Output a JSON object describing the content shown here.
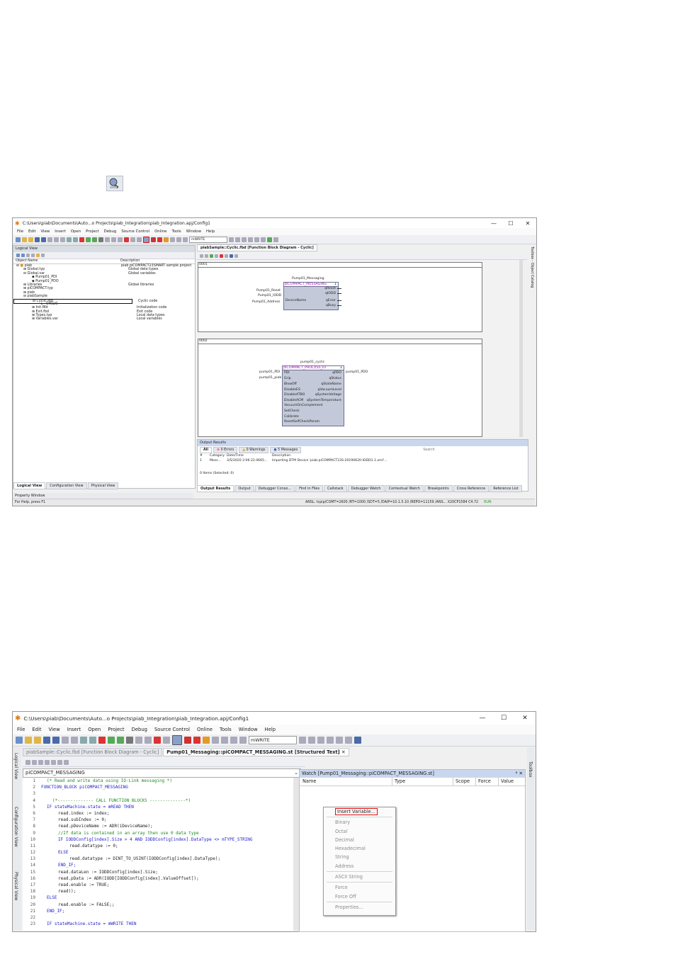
{
  "screen1": {
    "title": "C:\\Users\\piab\\Documents\\Auto...o Projects\\piab_Integration\\piab_Integration.apj/Config1",
    "menu": [
      "File",
      "Edit",
      "View",
      "Insert",
      "Open",
      "Project",
      "Debug",
      "Source Control",
      "Online",
      "Tools",
      "Window",
      "Help"
    ],
    "toolbar_combo": "mWRITE",
    "logical_view": {
      "header": "Logical View",
      "col_object": "Object Name",
      "col_desc": "Description",
      "rows": [
        {
          "name": "piab",
          "desc": "piab piCOMPACT23SMART sample project"
        },
        {
          "name": "Global.typ",
          "desc": "Global data types"
        },
        {
          "name": "Global.var",
          "desc": "Global variables"
        },
        {
          "name": "Pump01_PDI",
          "desc": ""
        },
        {
          "name": "Pump01_PDO",
          "desc": ""
        },
        {
          "name": "Libraries",
          "desc": "Global libraries"
        },
        {
          "name": "piCOMPACT.typ",
          "desc": ""
        },
        {
          "name": "piab",
          "desc": ""
        },
        {
          "name": "piabSample",
          "desc": ""
        },
        {
          "name": "Cyclic.fbd",
          "desc": "Cyclic code"
        },
        {
          "name": "_CYCLIC",
          "desc": ""
        },
        {
          "name": "Init.fbd",
          "desc": "Initialization code"
        },
        {
          "name": "Exit.fbd",
          "desc": "Exit code"
        },
        {
          "name": "Types.typ",
          "desc": "Local data types"
        },
        {
          "name": "Variables.var",
          "desc": "Local variables"
        }
      ],
      "bottom_tabs": [
        "Logical View",
        "Configuration View",
        "Physical View"
      ],
      "property_window": "Property Window"
    },
    "editor_tab": "piabSample::Cyclic.fbd [Function Block Diagram - Cyclic]",
    "network1": {
      "id": "0001",
      "instance": "Pump01_Messaging",
      "fb_type": "piCOMPACT_MESSAGING",
      "fb_index": "1",
      "inputs_external": [
        "Pump01_Reset",
        "Pump01_IODD",
        "Pump01_Address"
      ],
      "inputs": [
        "",
        "",
        "DeviceName"
      ],
      "outputs": [
        "qReset",
        "qIODD",
        "qError",
        "qBusy"
      ]
    },
    "network2": {
      "id": "0002",
      "instance": "pump01_cyclic",
      "fb_type": "piCOMPACT_PROCESS_IO",
      "fb_index": "1",
      "inputs_external": [
        "pump01_PDI",
        "pump01_piab"
      ],
      "inputs": [
        "PDI",
        "Grip",
        "BlowOff",
        "DisableES",
        "DisableATBO",
        "DisableACM",
        "VacuumOnComplement",
        "SetCheck",
        "Calibrate",
        "ResetSelfCheckParam"
      ],
      "outputs": [
        "qPDO",
        "qStatus",
        "qStateName",
        "qVacuumLevel",
        "qSystemVoltage",
        "qSystemTemperature"
      ],
      "output_external": "pump01_PDO"
    },
    "output": {
      "header": "Output Results",
      "filters": [
        "All",
        "0 Errors",
        "0 Warnings",
        "5 Messages"
      ],
      "search": "Search",
      "cols": [
        "#",
        "Category",
        "Date/Time",
        "Description"
      ],
      "row": {
        "num": "1",
        "category": "Mess...",
        "time": "3/5/2020 2:06:22.0665...",
        "desc": "Importing DTM Device 'piab-piCOMPACT23S-20190620-IODD1.1.xml'..."
      },
      "footer": "0 Items (Selected: 0)",
      "tabs": [
        "Output Results",
        "Output",
        "Debugger Conso...",
        "Find in Files",
        "Callstack",
        "Debugger Watch",
        "Contextual Watch",
        "Breakpoints",
        "Cross Reference",
        "Reference List"
      ]
    },
    "status_left": "For Help, press F1",
    "status_right": "ANSL: tcpip/COMT=2600 /RT=1000 /SDT=5 /DAIP=10.1.5.10 /REPO=11159 /ANS...  X20CP1584  C4.72",
    "status_run": "RUN",
    "side_tabs": "Toolbox - Object Catalog"
  },
  "screen2": {
    "title": "C:\\Users\\piab\\Documents\\Auto...o Projects\\piab_Integration\\piab_Integration.apj/Config1",
    "menu": [
      "File",
      "Edit",
      "View",
      "Insert",
      "Open",
      "Project",
      "Debug",
      "Source Control",
      "Online",
      "Tools",
      "Window",
      "Help"
    ],
    "toolbar_combo": "mWRITE",
    "tab_inactive": "piabSample::Cyclic.fbd [Function Block Diagram - Cyclic]",
    "tab_active": "Pump01_Messaging::piCOMPACT_MESSAGING.st [Structured Text]",
    "object_dropdown": "piCOMPACT_MESSAGING",
    "left_vtabs": [
      "Logical View",
      "Configuration View",
      "Physical View"
    ],
    "right_vtab": "Toolbox",
    "code": [
      {
        "n": "1",
        "t": "(* Read and write data using IO-Link messaging *)",
        "c": "cm",
        "i": 1
      },
      {
        "n": "2",
        "t": "FUNCTION_BLOCK piCOMPACT_MESSAGING",
        "c": "fbk",
        "i": 0
      },
      {
        "n": "3",
        "t": "",
        "c": "",
        "i": 0
      },
      {
        "n": "4",
        "t": "(*-------------- CALL FUNCTION BLOCKS --------------*)",
        "c": "cm",
        "i": 2
      },
      {
        "n": "5",
        "t": "IF stateMachine.state = mREAD THEN",
        "c": "if",
        "i": 1
      },
      {
        "n": "6",
        "t": "read.index := index;",
        "c": "",
        "i": 3
      },
      {
        "n": "7",
        "t": "read.subIndex := 0;",
        "c": "",
        "i": 3
      },
      {
        "n": "8",
        "t": "read.pDeviceName := ADR(iDeviceName);",
        "c": "adr",
        "i": 3
      },
      {
        "n": "9",
        "t": "//If data is contained in an array then use 0 data type",
        "c": "cm",
        "i": 3
      },
      {
        "n": "10",
        "t": "IF IODDConfig[index].Size > 4 AND IODDConfig[index].DataType <> mTYPE_STRING",
        "c": "if2",
        "i": 3
      },
      {
        "n": "11",
        "t": "read.datatype := 0;",
        "c": "",
        "i": 5
      },
      {
        "n": "12",
        "t": "ELSE",
        "c": "kw",
        "i": 3
      },
      {
        "n": "13",
        "t": "read.datatype := DINT_TO_USINT(IODDConfig[index].DataType);",
        "c": "dint",
        "i": 5
      },
      {
        "n": "14",
        "t": "END_IF;",
        "c": "kw",
        "i": 3
      },
      {
        "n": "15",
        "t": "read.dataLen := IODDConfig[index].Size;",
        "c": "",
        "i": 3
      },
      {
        "n": "16",
        "t": "read.pData := ADR(IODD[IODDConfig[index].ValueOffset]);",
        "c": "adr2",
        "i": 3
      },
      {
        "n": "17",
        "t": "read.enable := TRUE;",
        "c": "true",
        "i": 3
      },
      {
        "n": "18",
        "t": "read();",
        "c": "",
        "i": 3
      },
      {
        "n": "19",
        "t": "ELSE",
        "c": "kw",
        "i": 1
      },
      {
        "n": "20",
        "t": "read.enable := FALSE;;",
        "c": "false",
        "i": 3
      },
      {
        "n": "21",
        "t": "END_IF;",
        "c": "kw",
        "i": 1
      },
      {
        "n": "22",
        "t": "",
        "c": "",
        "i": 0
      },
      {
        "n": "23",
        "t": "IF stateMachine.state = mWRITE THEN",
        "c": "if",
        "i": 1
      }
    ],
    "watch": {
      "header": "Watch [Pump01_Messaging::piCOMPACT_MESSAGING.st]",
      "cols": [
        "Name",
        "Type",
        "Scope",
        "Force",
        "Value"
      ]
    },
    "context_menu": [
      {
        "label": "Insert Variable...",
        "enabled": true,
        "highlight": true
      },
      {
        "sep": true
      },
      {
        "label": "Binary",
        "enabled": false
      },
      {
        "label": "Octal",
        "enabled": false
      },
      {
        "label": "Decimal",
        "enabled": false
      },
      {
        "label": "Hexadecimal",
        "enabled": false
      },
      {
        "label": "String",
        "enabled": false
      },
      {
        "label": "Address",
        "enabled": false
      },
      {
        "sep": true
      },
      {
        "label": "ASCII String",
        "enabled": false
      },
      {
        "sep": true
      },
      {
        "label": "Force",
        "enabled": false
      },
      {
        "label": "Force Off",
        "enabled": false
      },
      {
        "sep": true
      },
      {
        "label": "Properties...",
        "enabled": false
      }
    ]
  }
}
